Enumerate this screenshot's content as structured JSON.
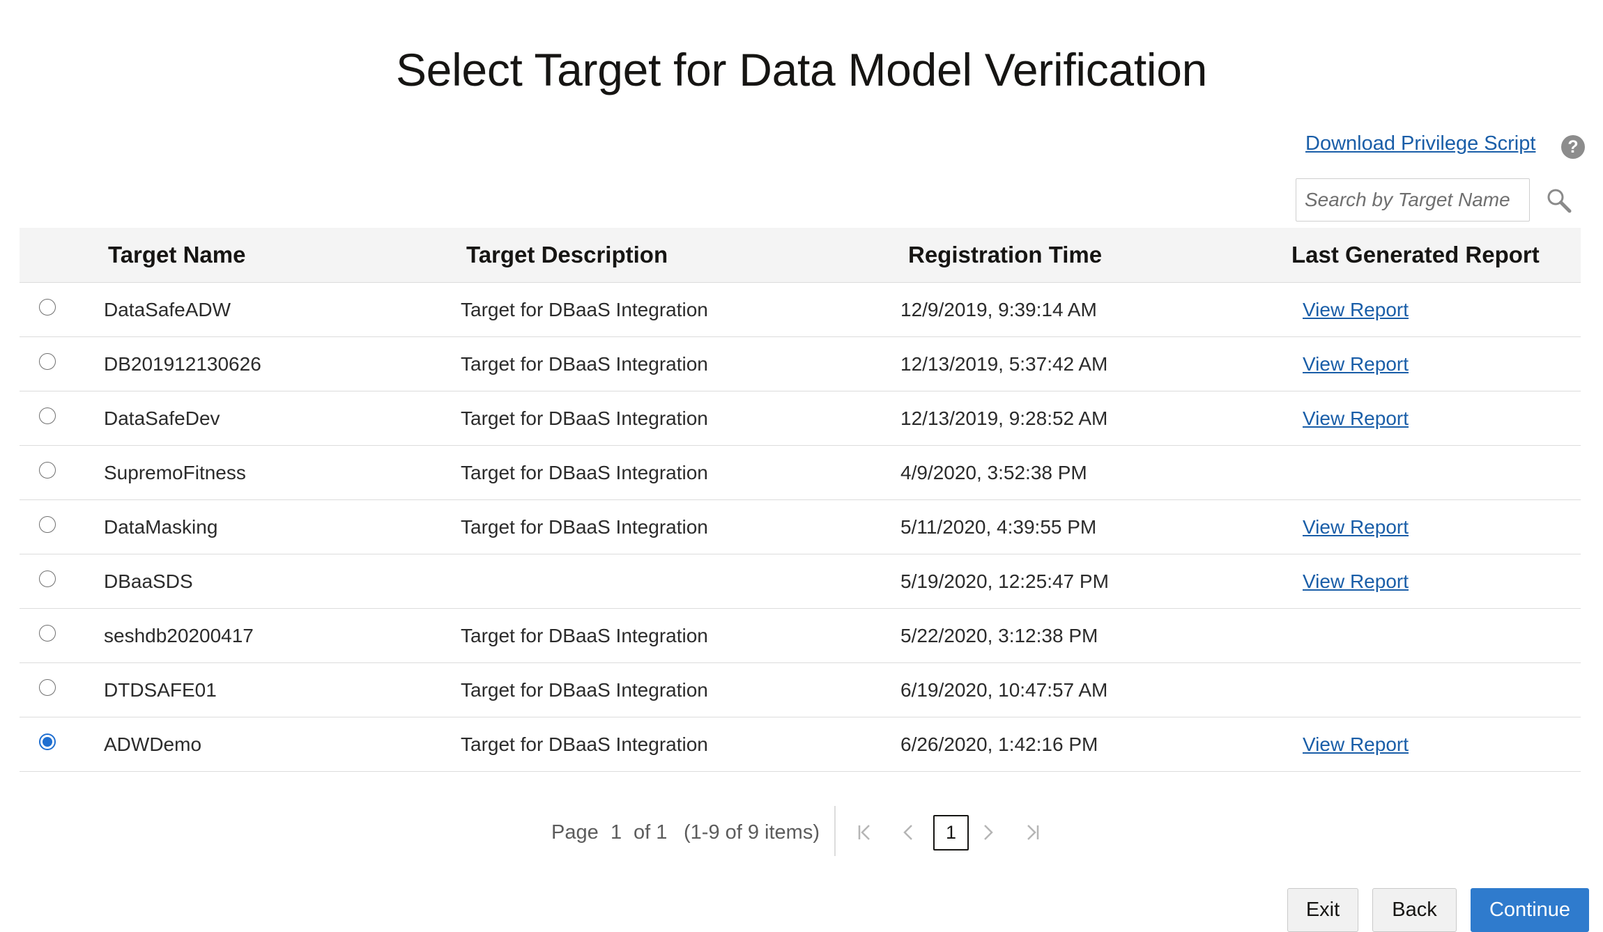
{
  "page": {
    "title": "Select Target for Data Model Verification"
  },
  "toolbar": {
    "download_link": "Download Privilege Script",
    "help_icon": "?",
    "search_placeholder": "Search by Target Name",
    "search_value": ""
  },
  "table": {
    "columns": {
      "name": "Target Name",
      "description": "Target Description",
      "time": "Registration Time",
      "report": "Last Generated Report"
    },
    "rows": [
      {
        "name": "DataSafeADW",
        "description": "Target for DBaaS Integration",
        "time": "12/9/2019, 9:39:14 AM",
        "report": "View Report",
        "selected": false
      },
      {
        "name": "DB201912130626",
        "description": "Target for DBaaS Integration",
        "time": "12/13/2019, 5:37:42 AM",
        "report": "View Report",
        "selected": false
      },
      {
        "name": "DataSafeDev",
        "description": "Target for DBaaS Integration",
        "time": "12/13/2019, 9:28:52 AM",
        "report": "View Report",
        "selected": false
      },
      {
        "name": "SupremoFitness",
        "description": "Target for DBaaS Integration",
        "time": "4/9/2020, 3:52:38 PM",
        "report": "",
        "selected": false
      },
      {
        "name": "DataMasking",
        "description": "Target for DBaaS Integration",
        "time": "5/11/2020, 4:39:55 PM",
        "report": "View Report",
        "selected": false
      },
      {
        "name": "DBaaSDS",
        "description": "",
        "time": "5/19/2020, 12:25:47 PM",
        "report": "View Report",
        "selected": false
      },
      {
        "name": "seshdb20200417",
        "description": "Target for DBaaS Integration",
        "time": "5/22/2020, 3:12:38 PM",
        "report": "",
        "selected": false
      },
      {
        "name": "DTDSAFE01",
        "description": "Target for DBaaS Integration",
        "time": "6/19/2020, 10:47:57 AM",
        "report": "",
        "selected": false
      },
      {
        "name": "ADWDemo",
        "description": "Target for DBaaS Integration",
        "time": "6/26/2020, 1:42:16 PM",
        "report": "View Report",
        "selected": true
      }
    ]
  },
  "pagination": {
    "page_label": "Page",
    "current_page": "1",
    "of_label": "of 1",
    "items_label": "(1-9 of 9 items)",
    "page_button": "1"
  },
  "actions": {
    "exit": "Exit",
    "back": "Back",
    "continue": "Continue"
  },
  "colors": {
    "link": "#1a5ea8",
    "primary": "#2f7bcd",
    "radio_selected": "#1f6fd1",
    "header_bg": "#f4f4f4"
  }
}
